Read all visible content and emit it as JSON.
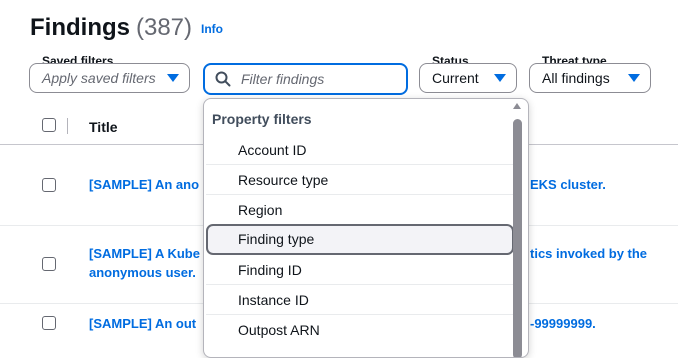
{
  "header": {
    "title": "Findings",
    "count": "(387)",
    "info": "Info"
  },
  "filters": {
    "saved": {
      "label": "Saved filters",
      "placeholder": "Apply saved filters"
    },
    "search": {
      "placeholder": "Filter findings"
    },
    "status": {
      "label": "Status",
      "value": "Current"
    },
    "threat": {
      "label": "Threat type",
      "value": "All findings"
    }
  },
  "table": {
    "title_header": "Title",
    "rows": [
      {
        "left": "[SAMPLE] An ano",
        "right": "EKS cluster."
      },
      {
        "left1": "[SAMPLE] A Kube",
        "right1": "tics invoked by the",
        "left2": "anonymous user."
      },
      {
        "left": "[SAMPLE] An out",
        "right": "-99999999."
      }
    ]
  },
  "dropdown": {
    "group": "Property filters",
    "items": [
      "Account ID",
      "Resource type",
      "Region",
      "Finding type",
      "Finding ID",
      "Instance ID",
      "Outpost ARN"
    ],
    "highlighted": "Finding type"
  },
  "colors": {
    "link": "#006ce0",
    "text": "#0f141a",
    "muted": "#656871"
  }
}
